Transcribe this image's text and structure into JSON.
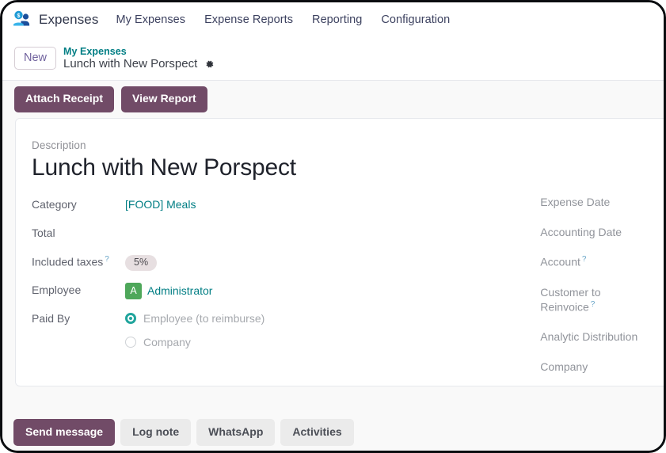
{
  "navbar": {
    "app_icon": "expenses-user-dollar-icon",
    "brand": "Expenses",
    "menu": [
      {
        "label": "My Expenses"
      },
      {
        "label": "Expense Reports"
      },
      {
        "label": "Reporting"
      },
      {
        "label": "Configuration"
      }
    ]
  },
  "breadcrumb": {
    "new_label": "New",
    "parent": "My Expenses",
    "current": "Lunch with New Porspect",
    "settings_icon": "gear-icon"
  },
  "control_panel": {
    "buttons": [
      {
        "label": "Attach Receipt"
      },
      {
        "label": "View Report"
      }
    ]
  },
  "form": {
    "description_label": "Description",
    "description_value": "Lunch with New Porspect",
    "left_fields": [
      {
        "label": "Category",
        "value": "[FOOD] Meals",
        "kind": "link"
      },
      {
        "label": "Total",
        "value": "",
        "kind": "text"
      },
      {
        "label": "Included taxes",
        "value": "5%",
        "kind": "tag",
        "help": "?"
      },
      {
        "label": "Employee",
        "value": "Administrator",
        "kind": "avatar",
        "avatar_initial": "A"
      },
      {
        "label": "Paid By",
        "value": "",
        "kind": "radio"
      }
    ],
    "paid_by_options": [
      {
        "label": "Employee (to reimburse)",
        "selected": true
      },
      {
        "label": "Company",
        "selected": false
      }
    ],
    "right_fields": [
      {
        "label": "Expense Date"
      },
      {
        "label": "Accounting Date"
      },
      {
        "label": "Account",
        "help": "?"
      },
      {
        "label": "Customer to Reinvoice",
        "help": "?"
      },
      {
        "label": "Analytic Distribution"
      },
      {
        "label": "Company"
      }
    ]
  },
  "chatter": {
    "buttons": [
      {
        "label": "Send message",
        "style": "primary"
      },
      {
        "label": "Log note",
        "style": "secondary"
      },
      {
        "label": "WhatsApp",
        "style": "secondary"
      },
      {
        "label": "Activities",
        "style": "secondary"
      }
    ]
  },
  "colors": {
    "primary": "#714b67",
    "link_teal": "#017e84",
    "avatar_green": "#4ea75a",
    "radio_teal": "#21a59d",
    "tag_bg": "#e7dfe1"
  }
}
